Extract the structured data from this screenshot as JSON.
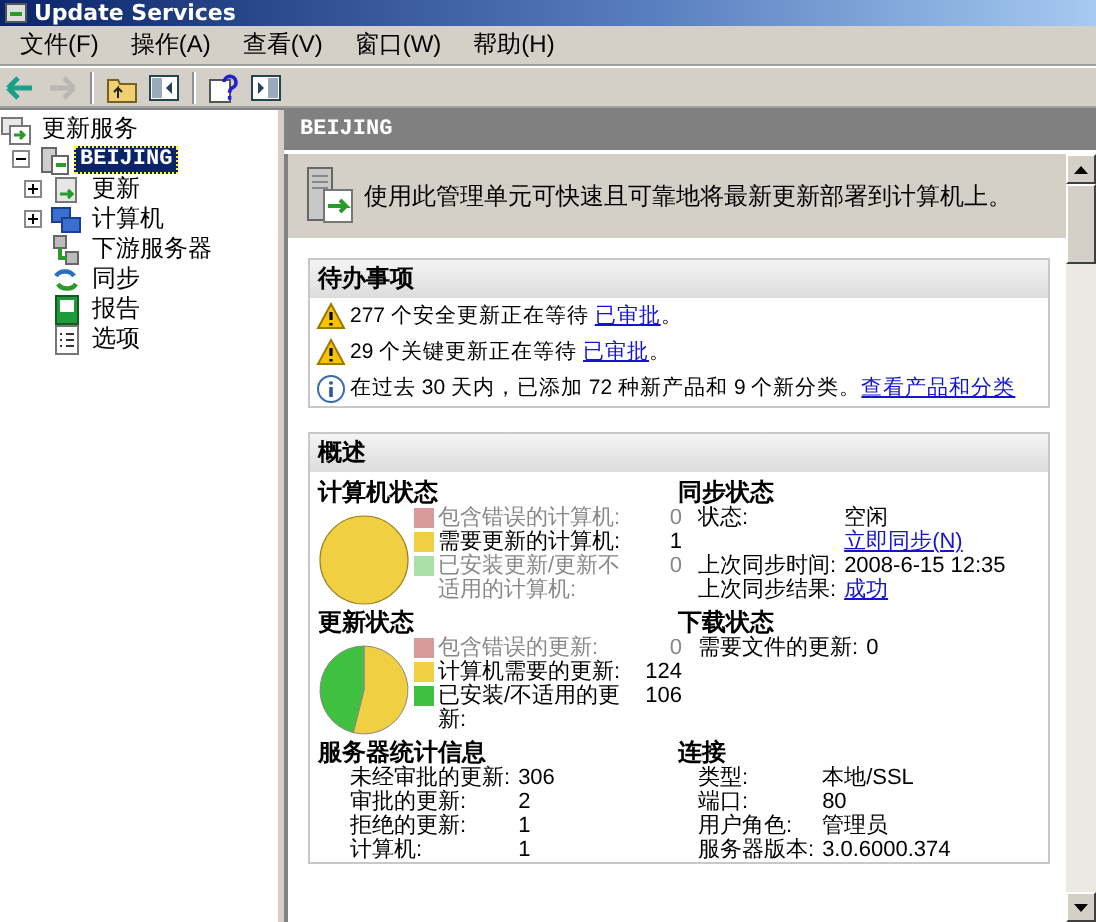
{
  "window": {
    "title": "Update Services"
  },
  "menu": [
    {
      "label": "文件(F)"
    },
    {
      "label": "操作(A)"
    },
    {
      "label": "查看(V)"
    },
    {
      "label": "窗口(W)"
    },
    {
      "label": "帮助(H)"
    }
  ],
  "toolbar": [
    {
      "kind": "back",
      "disabled": false
    },
    {
      "kind": "forward",
      "disabled": true
    },
    {
      "kind": "up",
      "disabled": false
    },
    {
      "kind": "tree",
      "disabled": false
    },
    {
      "kind": "help",
      "disabled": false
    },
    {
      "kind": "pane",
      "disabled": false
    }
  ],
  "tree": {
    "label": "更新服务",
    "kind": "root",
    "children": [
      {
        "label": "BEIJING",
        "kind": "server",
        "selected": true,
        "expanded": true,
        "children": [
          {
            "label": "更新",
            "kind": "updates",
            "selected": false,
            "expanded": false
          },
          {
            "label": "计算机",
            "kind": "computers",
            "selected": false,
            "expanded": false
          },
          {
            "label": "下游服务器",
            "kind": "downstream",
            "selected": false
          },
          {
            "label": "同步",
            "kind": "sync",
            "selected": false
          },
          {
            "label": "报告",
            "kind": "reports",
            "selected": false
          },
          {
            "label": "选项",
            "kind": "options",
            "selected": false
          }
        ]
      }
    ]
  },
  "header": "BEIJING",
  "intro": "使用此管理单元可快速且可靠地将最新更新部署到计算机上。",
  "todo": {
    "title": "待办事项",
    "items": [
      {
        "kind": "warning",
        "text": "277 个安全更新正在等待 ",
        "link": "已审批",
        "suffix": "。"
      },
      {
        "kind": "warning",
        "text": "29 个关键更新正在等待 ",
        "link": "已审批",
        "suffix": "。"
      },
      {
        "kind": "info",
        "text": "在过去 30 天内，已添加 72 种新产品和 9 个新分类。",
        "link": "查看产品和分类"
      }
    ]
  },
  "overview": {
    "title": "概述",
    "computer_status": {
      "title": "计算机状态",
      "legend": [
        {
          "label": "包含错误的计算机:",
          "value": "0",
          "color": "#d99a9a",
          "dimmed": true
        },
        {
          "label": "需要更新的计算机:",
          "value": "1",
          "color": "#f0d040",
          "dimmed": false
        },
        {
          "label": "已安装更新/更新不适用的计算机:",
          "value": "0",
          "color": "#a8e0a8",
          "dimmed": true
        }
      ]
    },
    "sync_status": {
      "title": "同步状态",
      "rows": [
        {
          "kind": "text",
          "label": "状态:",
          "value": "空闲"
        },
        {
          "kind": "link",
          "value": "立即同步(N)"
        },
        {
          "kind": "text",
          "label": "上次同步时间:",
          "value": "2008-6-15 12:35"
        },
        {
          "kind": "link",
          "label": "上次同步结果:",
          "value": "成功"
        }
      ]
    },
    "update_status": {
      "title": "更新状态",
      "legend": [
        {
          "label": "包含错误的更新:",
          "value": "0",
          "color": "#d99a9a",
          "dimmed": true
        },
        {
          "label": "计算机需要的更新:",
          "value": "124",
          "color": "#f0d040",
          "dimmed": false
        },
        {
          "label": "已安装/不适用的更新:",
          "value": "106",
          "color": "#40c040",
          "dimmed": false
        }
      ]
    },
    "download_status": {
      "title": "下载状态",
      "rows": [
        {
          "kind": "text",
          "label": "需要文件的更新:",
          "value": "0"
        }
      ]
    },
    "server_stats": {
      "title": "服务器统计信息",
      "rows": [
        {
          "kind": "text",
          "label": "未经审批的更新:",
          "value": "306"
        },
        {
          "kind": "text",
          "label": "审批的更新:",
          "value": "2"
        },
        {
          "kind": "text",
          "label": "拒绝的更新:",
          "value": "1"
        },
        {
          "kind": "text",
          "label": "计算机:",
          "value": "1"
        }
      ]
    },
    "connection": {
      "title": "连接",
      "rows": [
        {
          "kind": "text",
          "label": "类型:",
          "value": "本地/SSL"
        },
        {
          "kind": "text",
          "label": "端口:",
          "value": "80"
        },
        {
          "kind": "text",
          "label": "用户角色:",
          "value": "管理员"
        },
        {
          "kind": "text",
          "label": "服务器版本:",
          "value": "3.0.6000.374"
        }
      ]
    }
  }
}
